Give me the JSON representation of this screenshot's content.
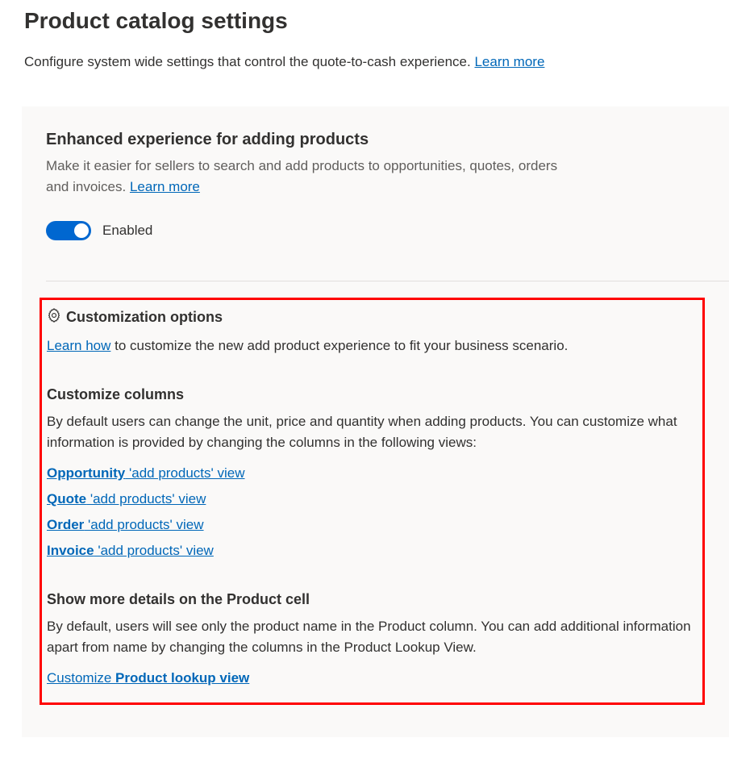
{
  "page": {
    "title": "Product catalog settings",
    "desc_text": "Configure system wide settings that control the quote-to-cash experience. ",
    "learn_more": "Learn more"
  },
  "enhanced": {
    "title": "Enhanced experience for adding products",
    "desc": "Make it easier for sellers to search and add products to opportunities, quotes, orders and invoices. ",
    "learn_more": "Learn more",
    "toggle_label": "Enabled"
  },
  "custom": {
    "header": "Customization options",
    "learn_how": "Learn how",
    "desc_rest": " to customize the new add product experience to fit your business scenario.",
    "columns": {
      "title": "Customize columns",
      "desc": "By default users can change the unit, price and quantity when adding products. You can customize what information is provided by changing the columns in the following views:",
      "links": [
        {
          "bold": "Opportunity",
          "rest": " 'add products' view"
        },
        {
          "bold": "Quote",
          "rest": " 'add products' view"
        },
        {
          "bold": "Order",
          "rest": " 'add products' view"
        },
        {
          "bold": "Invoice",
          "rest": " 'add products' view"
        }
      ]
    },
    "product_cell": {
      "title": "Show more details on the Product cell",
      "desc": "By default, users will see only the product name in the Product column. You can add additional information apart from name by changing the columns in the Product Lookup View.",
      "link_prefix": "Customize ",
      "link_bold": "Product lookup view"
    }
  }
}
